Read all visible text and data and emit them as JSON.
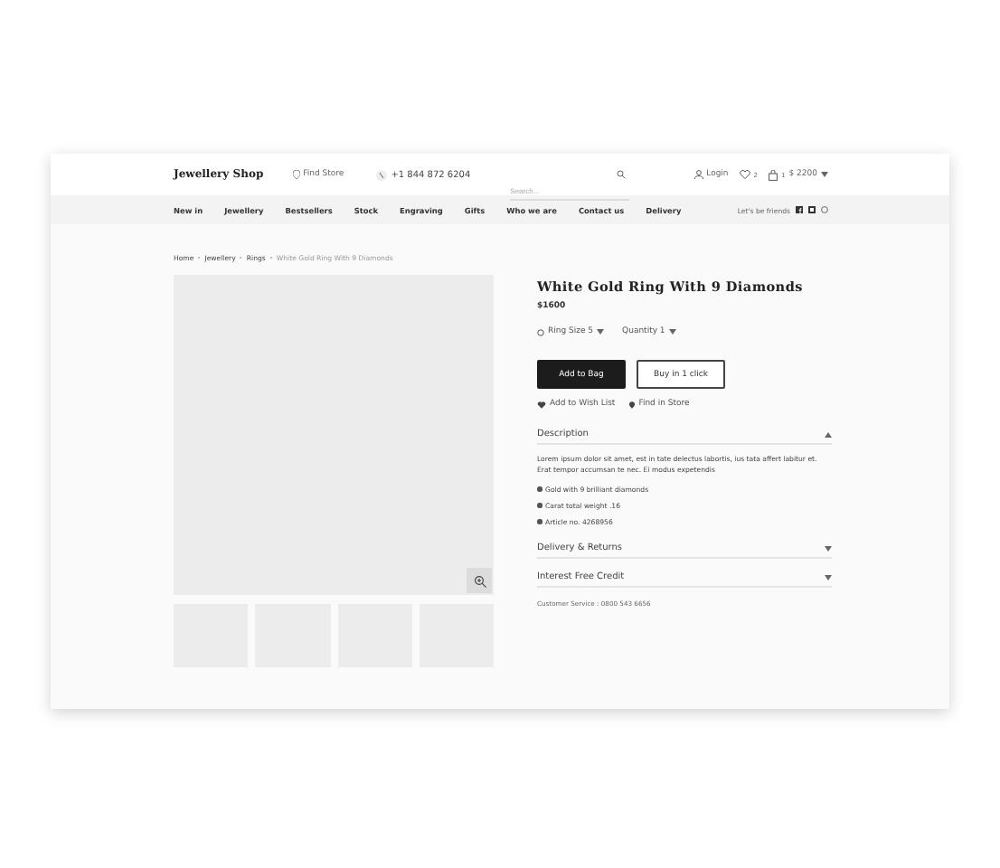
{
  "header": {
    "logo": "Jewellery Shop",
    "find_store": "Find Store",
    "phone": "+1 844 872 6204",
    "search": {
      "placeholder": "Search..."
    },
    "login": "Login",
    "wishlist_count": "2",
    "cart_count": "1",
    "cart_total": "$ 2200"
  },
  "nav": {
    "items": [
      {
        "label": "New in"
      },
      {
        "label": "Jewellery"
      },
      {
        "label": "Bestsellers"
      },
      {
        "label": "Stock"
      },
      {
        "label": "Engraving"
      },
      {
        "label": "Gifts"
      },
      {
        "label": "Who we are"
      },
      {
        "label": "Contact us"
      },
      {
        "label": "Delivery"
      }
    ],
    "social_label": "Let's be friends"
  },
  "breadcrumb": [
    {
      "label": "Home",
      "current": false
    },
    {
      "label": "Jewellery",
      "current": false
    },
    {
      "label": "Rings",
      "current": false
    },
    {
      "label": "White Gold Ring With 9 Diamonds",
      "current": true
    }
  ],
  "product": {
    "title": "White Gold Ring With 9 Diamonds",
    "price": "$1600",
    "options": [
      {
        "label": "Ring Size 5",
        "kind": "ring"
      },
      {
        "label": "Quantity 1",
        "kind": "plain"
      }
    ],
    "buttons": [
      {
        "label": "Add to Bag",
        "kind": "primary"
      },
      {
        "label": "Buy in 1 click",
        "kind": "outline"
      }
    ],
    "links": [
      {
        "label": "Add to Wish List",
        "kind": "heart"
      },
      {
        "label": "Find in Store",
        "kind": "pin"
      }
    ],
    "sections": [
      {
        "title": "Description",
        "expanded": true,
        "text": "Lorem ipsum dolor sit amet, est in tate delectus labortis, ius tata affert labitur et. Erat tempor accumsan te nec. Ei modus expetendis",
        "bullets": [
          "Gold with 9 brilliant diamonds",
          "Carat total weight .16",
          "Article no. 4268956"
        ]
      },
      {
        "title": "Delivery & Returns",
        "expanded": false
      },
      {
        "title": "Interest Free Credit",
        "expanded": false
      }
    ],
    "customer_service": "Customer Service : 0800 543 6656"
  }
}
